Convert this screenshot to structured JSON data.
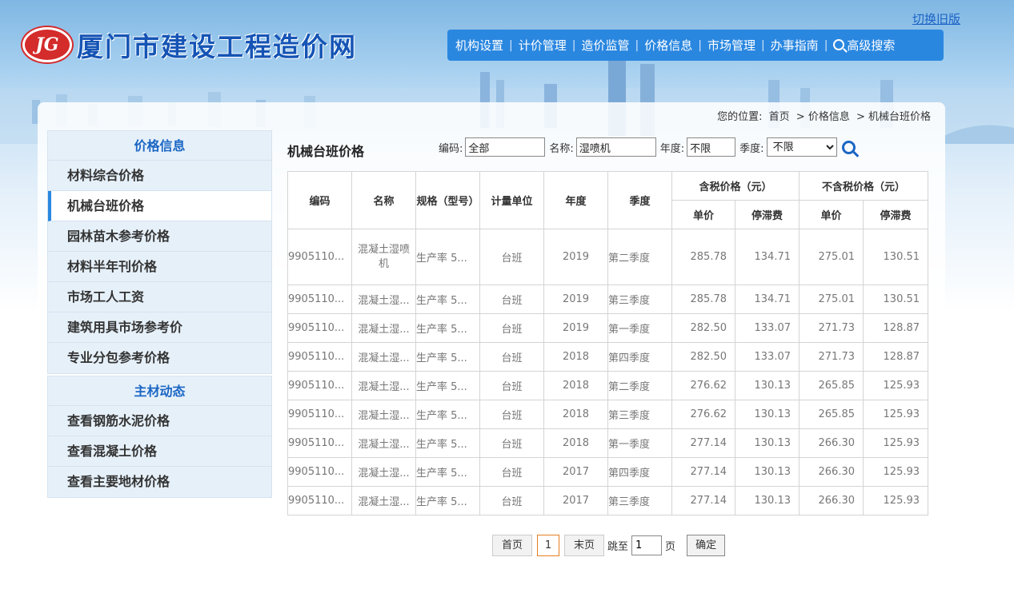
{
  "header": {
    "switch_label": "切换旧版",
    "logo_badge": "JG",
    "logo_text": "厦门市建设工程造价网",
    "nav": [
      "机构设置",
      "计价管理",
      "造价监管",
      "价格信息",
      "市场管理",
      "办事指南"
    ],
    "advanced_search": "高级搜索"
  },
  "breadcrumb": {
    "prefix": "您的位置:",
    "items": [
      "首页",
      "> 价格信息",
      "> 机械台班价格"
    ]
  },
  "sidebar": {
    "group1": {
      "title": "价格信息",
      "items": [
        "材料综合价格",
        "机械台班价格",
        "园林苗木参考价格",
        "材料半年刊价格",
        "市场工人工资",
        "建筑用具市场参考价",
        "专业分包参考价格"
      ]
    },
    "group2": {
      "title": "主材动态",
      "items": [
        "查看钢筋水泥价格",
        "查看混凝土价格",
        "查看主要地材价格"
      ]
    }
  },
  "content": {
    "title": "机械台班价格",
    "filters": {
      "code_label": "编码:",
      "code_value": "全部",
      "name_label": "名称:",
      "name_value": "湿喷机",
      "year_label": "年度:",
      "year_value": "不限",
      "quarter_label": "季度:",
      "quarter_value": "不限"
    }
  },
  "table": {
    "headers": {
      "code": "编码",
      "name": "名称",
      "spec": "规格（型号）",
      "unit": "计量单位",
      "year": "年度",
      "quarter": "季度",
      "tax_group": "含税价格（元）",
      "notax_group": "不含税价格（元）",
      "unit_price": "单价",
      "idle_fee": "停滞费"
    },
    "rows": [
      {
        "code": "9905110...",
        "name": "混凝土湿喷机",
        "spec": "生产率 5...",
        "unit": "台班",
        "year": "2019",
        "quarter": "第二季度",
        "tax_price": "285.78",
        "tax_idle": "134.71",
        "notax_price": "275.01",
        "notax_idle": "130.51"
      },
      {
        "code": "9905110...",
        "name": "混凝土湿...",
        "spec": "生产率 5...",
        "unit": "台班",
        "year": "2019",
        "quarter": "第三季度",
        "tax_price": "285.78",
        "tax_idle": "134.71",
        "notax_price": "275.01",
        "notax_idle": "130.51"
      },
      {
        "code": "9905110...",
        "name": "混凝土湿...",
        "spec": "生产率 5...",
        "unit": "台班",
        "year": "2019",
        "quarter": "第一季度",
        "tax_price": "282.50",
        "tax_idle": "133.07",
        "notax_price": "271.73",
        "notax_idle": "128.87"
      },
      {
        "code": "9905110...",
        "name": "混凝土湿...",
        "spec": "生产率 5...",
        "unit": "台班",
        "year": "2018",
        "quarter": "第四季度",
        "tax_price": "282.50",
        "tax_idle": "133.07",
        "notax_price": "271.73",
        "notax_idle": "128.87"
      },
      {
        "code": "9905110...",
        "name": "混凝土湿...",
        "spec": "生产率 5...",
        "unit": "台班",
        "year": "2018",
        "quarter": "第二季度",
        "tax_price": "276.62",
        "tax_idle": "130.13",
        "notax_price": "265.85",
        "notax_idle": "125.93"
      },
      {
        "code": "9905110...",
        "name": "混凝土湿...",
        "spec": "生产率 5...",
        "unit": "台班",
        "year": "2018",
        "quarter": "第三季度",
        "tax_price": "276.62",
        "tax_idle": "130.13",
        "notax_price": "265.85",
        "notax_idle": "125.93"
      },
      {
        "code": "9905110...",
        "name": "混凝土湿...",
        "spec": "生产率 5...",
        "unit": "台班",
        "year": "2018",
        "quarter": "第一季度",
        "tax_price": "277.14",
        "tax_idle": "130.13",
        "notax_price": "266.30",
        "notax_idle": "125.93"
      },
      {
        "code": "9905110...",
        "name": "混凝土湿...",
        "spec": "生产率 5...",
        "unit": "台班",
        "year": "2017",
        "quarter": "第四季度",
        "tax_price": "277.14",
        "tax_idle": "130.13",
        "notax_price": "266.30",
        "notax_idle": "125.93"
      },
      {
        "code": "9905110...",
        "name": "混凝土湿...",
        "spec": "生产率 5...",
        "unit": "台班",
        "year": "2017",
        "quarter": "第三季度",
        "tax_price": "277.14",
        "tax_idle": "130.13",
        "notax_price": "266.30",
        "notax_idle": "125.93"
      }
    ]
  },
  "pager": {
    "first": "首页",
    "current": "1",
    "last": "末页",
    "jump_label": "跳至",
    "jump_value": "1",
    "page_suffix": "页",
    "confirm": "确定"
  },
  "colors": {
    "accent": "#2a87e0",
    "title_blue": "#1a66c4",
    "logo_red": "#d42b2b"
  }
}
